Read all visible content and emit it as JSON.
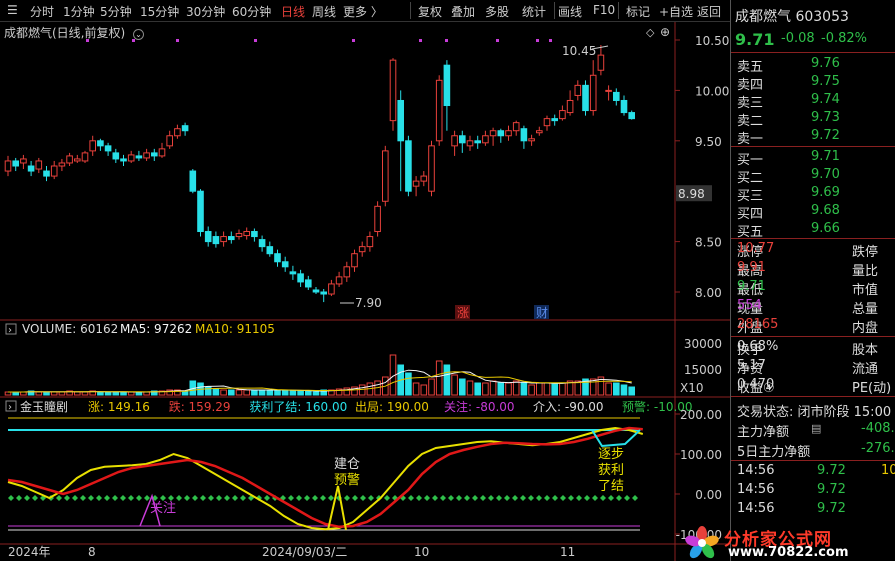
{
  "toolbar": {
    "items": [
      "分时",
      "1分钟",
      "5分钟",
      "15分钟",
      "30分钟",
      "60分钟",
      "日线",
      "周线",
      "更多 〉",
      "复权",
      "叠加",
      "多股",
      "统计",
      "画线",
      "F10",
      "标记",
      "+自选",
      "返回"
    ],
    "active": "日线"
  },
  "chart": {
    "title": "成都燃气(日线,前复权)",
    "price_ticks": [
      "10.50",
      "10.00",
      "9.50",
      "8.98",
      "8.50",
      "8.00"
    ],
    "high_label": "10.45",
    "low_label": "7.90",
    "markers": [
      "涨",
      "财"
    ],
    "volume_label": "VOLUME: 60162",
    "ma5_label": "MA5: 97262",
    "ma10_label": "MA10: 91105",
    "volume_ticks": [
      "30000",
      "15000",
      "X10"
    ],
    "indicator": {
      "name": "金玉瞳剧",
      "items": [
        {
          "text": "涨: 149.16",
          "color": "#e8c800"
        },
        {
          "text": "跌: 159.29",
          "color": "#e8413b"
        },
        {
          "text": "获利了结: 160.00",
          "color": "#28e0e8"
        },
        {
          "text": "出局: 190.00",
          "color": "#e8c800"
        },
        {
          "text": "关注: -80.00",
          "color": "#c83cd8"
        },
        {
          "text": "介入: -90.00",
          "color": "#ddd"
        },
        {
          "text": "预警: -10.00",
          "color": "#2fbf4a"
        }
      ],
      "ticks": [
        "200.00",
        "100.00",
        "0.00",
        "-100.00"
      ],
      "annotations": {
        "guanzhu": "关注",
        "jiancang": "建仓",
        "yujing": "预警",
        "zhubu": "逐步",
        "huoli": "获利",
        "liaojie": "了结"
      }
    },
    "date_axis": [
      "2024年",
      "8",
      "2024/09/03/二",
      "10",
      "11"
    ]
  },
  "quote": {
    "name": "成都燃气",
    "code": "603053",
    "price": "9.71",
    "change": "-0.08",
    "change_pct": "-0.82%",
    "asks": [
      {
        "label": "卖五",
        "price": "9.76"
      },
      {
        "label": "卖四",
        "price": "9.75"
      },
      {
        "label": "卖三",
        "price": "9.74"
      },
      {
        "label": "卖二",
        "price": "9.73"
      },
      {
        "label": "卖一",
        "price": "9.72"
      }
    ],
    "bids": [
      {
        "label": "买一",
        "price": "9.71"
      },
      {
        "label": "买二",
        "price": "9.70"
      },
      {
        "label": "买三",
        "price": "9.69"
      },
      {
        "label": "买四",
        "price": "9.68"
      },
      {
        "label": "买五",
        "price": "9.66"
      }
    ],
    "stats": [
      {
        "l1": "涨停",
        "v1": "10.77",
        "c1": "red",
        "l2": "跌停"
      },
      {
        "l1": "最高",
        "v1": "9.91",
        "c1": "red",
        "l2": "量比"
      },
      {
        "l1": "最低",
        "v1": "9.71",
        "c1": "green",
        "l2": "市值"
      },
      {
        "l1": "现量",
        "v1": "554",
        "c1": "purple",
        "l2": "总量"
      },
      {
        "l1": "外盘",
        "v1": "28165",
        "c1": "red",
        "l2": "内盘"
      }
    ],
    "stats2": [
      {
        "l1": "换手",
        "v1": "0.68%",
        "l2": "股本"
      },
      {
        "l1": "净资",
        "v1": "5.17",
        "l2": "流通"
      },
      {
        "l1": "收益④",
        "v1": "0.470",
        "l2": "PE(动)"
      }
    ],
    "trade_status": "交易状态: 闭市阶段 15:00",
    "main_flow": "主力净额",
    "main_flow_val": "-408.",
    "flow5": "5日主力净额",
    "flow5_val": "-276.",
    "ticks": [
      {
        "t": "14:56",
        "p": "9.72",
        "v": "10"
      },
      {
        "t": "14:56",
        "p": "9.72",
        "v": ""
      },
      {
        "t": "14:56",
        "p": "9.72",
        "v": ""
      }
    ]
  },
  "watermark": {
    "line1": "分析家公式网",
    "line2": "www.70822.com"
  },
  "colors": {
    "up": "#e8413b",
    "down": "#28e0e8",
    "ma5": "#f5f5f5",
    "ma10": "#e8c800"
  }
}
